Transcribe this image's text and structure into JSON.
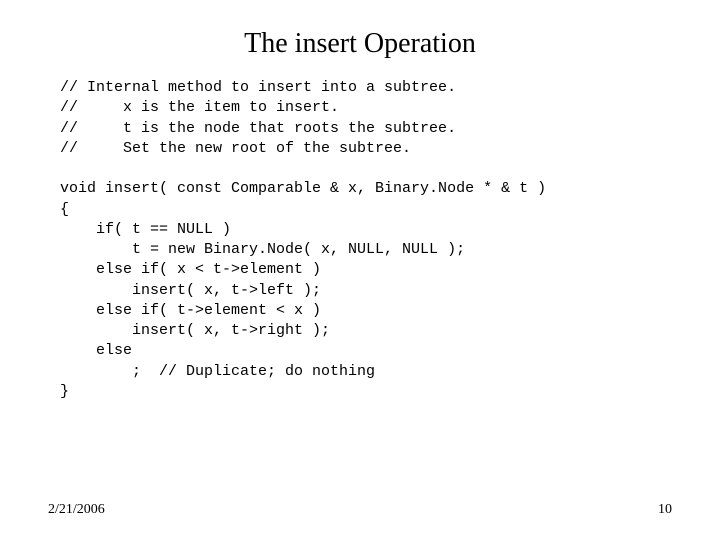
{
  "title": "The insert Operation",
  "code": "// Internal method to insert into a subtree.\n//     x is the item to insert.\n//     t is the node that roots the subtree.\n//     Set the new root of the subtree.\n\nvoid insert( const Comparable & x, Binary.Node * & t )\n{\n    if( t == NULL )\n        t = new Binary.Node( x, NULL, NULL );\n    else if( x < t->element )\n        insert( x, t->left );\n    else if( t->element < x )\n        insert( x, t->right );\n    else\n        ;  // Duplicate; do nothing\n}",
  "footer": {
    "date": "2/21/2006",
    "page": "10"
  }
}
